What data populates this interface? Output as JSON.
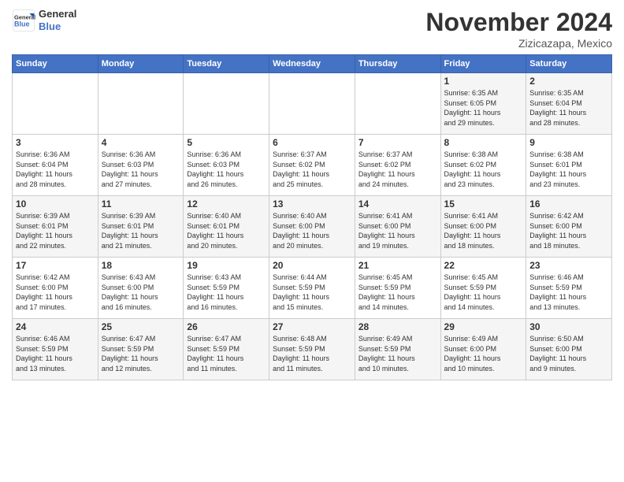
{
  "header": {
    "logo_general": "General",
    "logo_blue": "Blue",
    "month_title": "November 2024",
    "location": "Zizicazapa, Mexico"
  },
  "weekdays": [
    "Sunday",
    "Monday",
    "Tuesday",
    "Wednesday",
    "Thursday",
    "Friday",
    "Saturday"
  ],
  "weeks": [
    [
      {
        "day": "",
        "info": ""
      },
      {
        "day": "",
        "info": ""
      },
      {
        "day": "",
        "info": ""
      },
      {
        "day": "",
        "info": ""
      },
      {
        "day": "",
        "info": ""
      },
      {
        "day": "1",
        "info": "Sunrise: 6:35 AM\nSunset: 6:05 PM\nDaylight: 11 hours and 29 minutes."
      },
      {
        "day": "2",
        "info": "Sunrise: 6:35 AM\nSunset: 6:04 PM\nDaylight: 11 hours and 28 minutes."
      }
    ],
    [
      {
        "day": "3",
        "info": "Sunrise: 6:36 AM\nSunset: 6:04 PM\nDaylight: 11 hours and 28 minutes."
      },
      {
        "day": "4",
        "info": "Sunrise: 6:36 AM\nSunset: 6:03 PM\nDaylight: 11 hours and 27 minutes."
      },
      {
        "day": "5",
        "info": "Sunrise: 6:36 AM\nSunset: 6:03 PM\nDaylight: 11 hours and 26 minutes."
      },
      {
        "day": "6",
        "info": "Sunrise: 6:37 AM\nSunset: 6:02 PM\nDaylight: 11 hours and 25 minutes."
      },
      {
        "day": "7",
        "info": "Sunrise: 6:37 AM\nSunset: 6:02 PM\nDaylight: 11 hours and 24 minutes."
      },
      {
        "day": "8",
        "info": "Sunrise: 6:38 AM\nSunset: 6:02 PM\nDaylight: 11 hours and 23 minutes."
      },
      {
        "day": "9",
        "info": "Sunrise: 6:38 AM\nSunset: 6:01 PM\nDaylight: 11 hours and 23 minutes."
      }
    ],
    [
      {
        "day": "10",
        "info": "Sunrise: 6:39 AM\nSunset: 6:01 PM\nDaylight: 11 hours and 22 minutes."
      },
      {
        "day": "11",
        "info": "Sunrise: 6:39 AM\nSunset: 6:01 PM\nDaylight: 11 hours and 21 minutes."
      },
      {
        "day": "12",
        "info": "Sunrise: 6:40 AM\nSunset: 6:01 PM\nDaylight: 11 hours and 20 minutes."
      },
      {
        "day": "13",
        "info": "Sunrise: 6:40 AM\nSunset: 6:00 PM\nDaylight: 11 hours and 20 minutes."
      },
      {
        "day": "14",
        "info": "Sunrise: 6:41 AM\nSunset: 6:00 PM\nDaylight: 11 hours and 19 minutes."
      },
      {
        "day": "15",
        "info": "Sunrise: 6:41 AM\nSunset: 6:00 PM\nDaylight: 11 hours and 18 minutes."
      },
      {
        "day": "16",
        "info": "Sunrise: 6:42 AM\nSunset: 6:00 PM\nDaylight: 11 hours and 18 minutes."
      }
    ],
    [
      {
        "day": "17",
        "info": "Sunrise: 6:42 AM\nSunset: 6:00 PM\nDaylight: 11 hours and 17 minutes."
      },
      {
        "day": "18",
        "info": "Sunrise: 6:43 AM\nSunset: 6:00 PM\nDaylight: 11 hours and 16 minutes."
      },
      {
        "day": "19",
        "info": "Sunrise: 6:43 AM\nSunset: 5:59 PM\nDaylight: 11 hours and 16 minutes."
      },
      {
        "day": "20",
        "info": "Sunrise: 6:44 AM\nSunset: 5:59 PM\nDaylight: 11 hours and 15 minutes."
      },
      {
        "day": "21",
        "info": "Sunrise: 6:45 AM\nSunset: 5:59 PM\nDaylight: 11 hours and 14 minutes."
      },
      {
        "day": "22",
        "info": "Sunrise: 6:45 AM\nSunset: 5:59 PM\nDaylight: 11 hours and 14 minutes."
      },
      {
        "day": "23",
        "info": "Sunrise: 6:46 AM\nSunset: 5:59 PM\nDaylight: 11 hours and 13 minutes."
      }
    ],
    [
      {
        "day": "24",
        "info": "Sunrise: 6:46 AM\nSunset: 5:59 PM\nDaylight: 11 hours and 13 minutes."
      },
      {
        "day": "25",
        "info": "Sunrise: 6:47 AM\nSunset: 5:59 PM\nDaylight: 11 hours and 12 minutes."
      },
      {
        "day": "26",
        "info": "Sunrise: 6:47 AM\nSunset: 5:59 PM\nDaylight: 11 hours and 11 minutes."
      },
      {
        "day": "27",
        "info": "Sunrise: 6:48 AM\nSunset: 5:59 PM\nDaylight: 11 hours and 11 minutes."
      },
      {
        "day": "28",
        "info": "Sunrise: 6:49 AM\nSunset: 5:59 PM\nDaylight: 11 hours and 10 minutes."
      },
      {
        "day": "29",
        "info": "Sunrise: 6:49 AM\nSunset: 6:00 PM\nDaylight: 11 hours and 10 minutes."
      },
      {
        "day": "30",
        "info": "Sunrise: 6:50 AM\nSunset: 6:00 PM\nDaylight: 11 hours and 9 minutes."
      }
    ]
  ]
}
